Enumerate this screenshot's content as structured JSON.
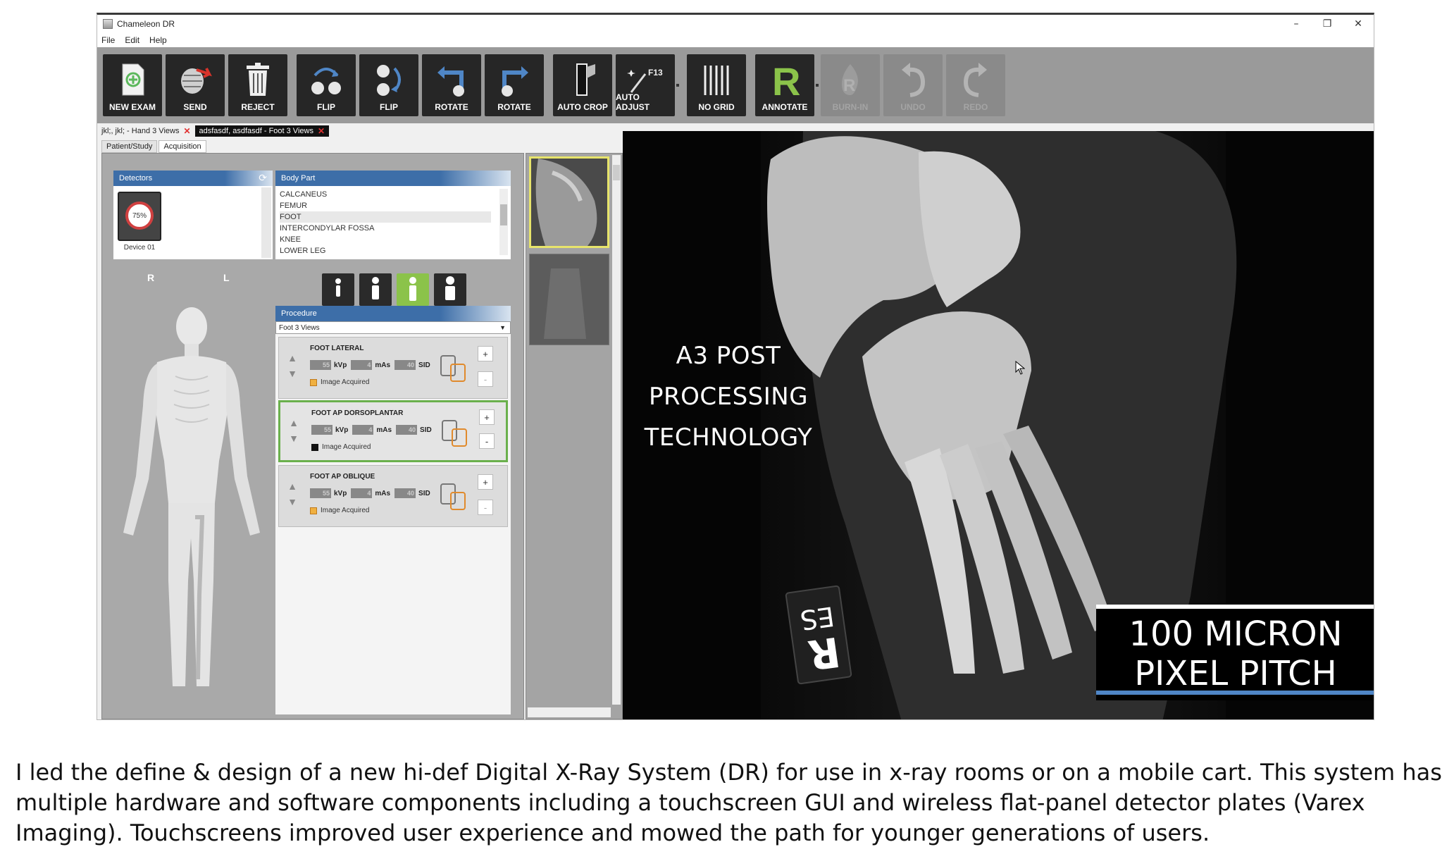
{
  "window": {
    "title": "Chameleon DR",
    "controls": [
      "–",
      "❐",
      "✕"
    ]
  },
  "menu": [
    "File",
    "Edit",
    "Help"
  ],
  "toolbar": [
    {
      "label": "NEW EXAM",
      "icon": "new-exam-icon"
    },
    {
      "label": "SEND",
      "icon": "send-icon"
    },
    {
      "label": "REJECT",
      "icon": "trash-icon"
    },
    {
      "label": "FLIP",
      "icon": "flip-vertical-icon"
    },
    {
      "label": "FLIP",
      "icon": "flip-horizontal-icon"
    },
    {
      "label": "ROTATE",
      "icon": "rotate-left-icon"
    },
    {
      "label": "ROTATE",
      "icon": "rotate-right-icon"
    },
    {
      "label": "AUTO CROP",
      "icon": "auto-crop-icon"
    },
    {
      "label": "AUTO ADJUST",
      "icon": "auto-adjust-icon"
    },
    {
      "label": "NO GRID",
      "icon": "grid-icon"
    },
    {
      "label": "ANNOTATE",
      "icon": "annotate-r-icon"
    },
    {
      "label": "BURN-IN",
      "icon": "burn-in-icon"
    },
    {
      "label": "UNDO",
      "icon": "undo-icon"
    },
    {
      "label": "REDO",
      "icon": "redo-icon"
    }
  ],
  "doc_tabs": [
    {
      "label": "jkl;, jkl; - Hand 3 Views",
      "active": false
    },
    {
      "label": "adsfasdf, asdfasdf - Foot 3 Views",
      "active": true
    }
  ],
  "sub_tabs": [
    "Patient/Study",
    "Acquisition"
  ],
  "detectors": {
    "header": "Detectors",
    "device_level": "75%",
    "device_name": "Device 01"
  },
  "body_part": {
    "header": "Body Part",
    "items": [
      "CALCANEUS",
      "FEMUR",
      "FOOT",
      "INTERCONDYLAR FOSSA",
      "KNEE",
      "LOWER LEG"
    ],
    "selected": "FOOT"
  },
  "side_labels": {
    "right": "R",
    "left": "L"
  },
  "procedure": {
    "header": "Procedure",
    "selected": "Foot 3 Views",
    "items": [
      {
        "name": "FOOT  LATERAL",
        "kvp": "55",
        "mas": "4",
        "sid": "40",
        "kvp_unit": "kVp",
        "mas_unit": "mAs",
        "sid_unit": "SID",
        "status": "Image Acquired",
        "acquired": true,
        "active": false
      },
      {
        "name": "FOOT  AP DORSOPLANTAR",
        "kvp": "55",
        "mas": "4",
        "sid": "40",
        "kvp_unit": "kVp",
        "mas_unit": "mAs",
        "sid_unit": "SID",
        "status": "Image Acquired",
        "acquired": false,
        "active": true
      },
      {
        "name": "FOOT  AP OBLIQUE",
        "kvp": "55",
        "mas": "4",
        "sid": "40",
        "kvp_unit": "kVp",
        "mas_unit": "mAs",
        "sid_unit": "SID",
        "status": "Image Acquired",
        "acquired": true,
        "active": false
      }
    ]
  },
  "viewer": {
    "overlay_left": [
      "A3 POST",
      "PROCESSING",
      "TECHNOLOGY"
    ],
    "overlay_right": [
      "100 MICRON",
      "PIXEL PITCH"
    ],
    "marker_text": "ES",
    "marker_letter": "R"
  },
  "caption": "I led the define & design of a new hi-def Digital X-Ray System (DR) for use in  x-ray rooms or on a mobile cart. This system has multiple hardware and software components including a touchscreen GUI and wireless flat-panel detector plates (Varex Imaging). Touchscreens improved user experience and mowed the path for younger generations of users.",
  "colors": {
    "toolbar_bg": "#9a9a9a",
    "button_bg": "#262626",
    "panel_header": "#3d6ea8",
    "active_green": "#6ab04c",
    "accent_blue": "#4f86c6"
  }
}
